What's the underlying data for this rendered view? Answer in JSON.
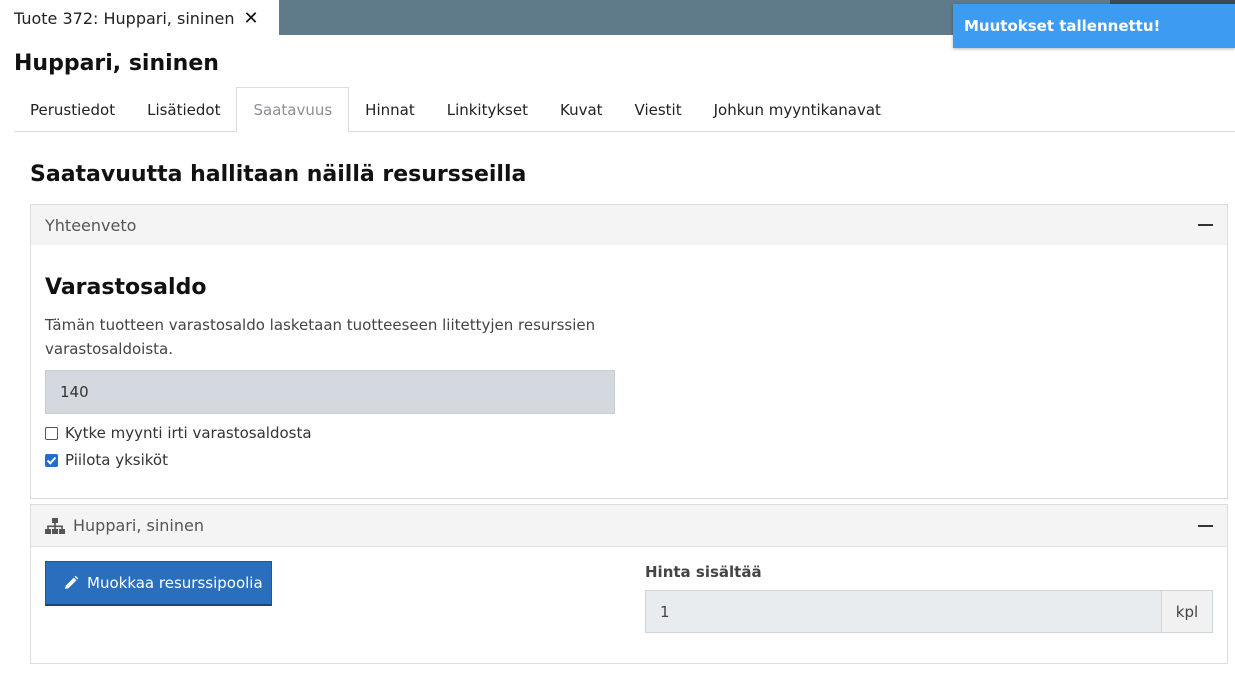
{
  "document_tab": {
    "title": "Tuote 372: Huppari, sininen",
    "close_glyph": "✕"
  },
  "toast": {
    "message": "Muutokset tallennettu!"
  },
  "page": {
    "title": "Huppari, sininen"
  },
  "tabs": [
    {
      "label": "Perustiedot",
      "active": false
    },
    {
      "label": "Lisätiedot",
      "active": false
    },
    {
      "label": "Saatavuus",
      "active": true
    },
    {
      "label": "Hinnat",
      "active": false
    },
    {
      "label": "Linkitykset",
      "active": false
    },
    {
      "label": "Kuvat",
      "active": false
    },
    {
      "label": "Viestit",
      "active": false
    },
    {
      "label": "Johkun myyntikanavat",
      "active": false
    }
  ],
  "availability": {
    "section_title": "Saatavuutta hallitaan näillä resursseilla",
    "summary_panel": {
      "header": "Yhteenveto",
      "subheading": "Varastosaldo",
      "description": "Tämän tuotteen varastosaldo lasketaan tuotteeseen liitettyjen resurssien varastosaldoista.",
      "stock_value": "140",
      "checkboxes": [
        {
          "label": "Kytke myynti irti varastosaldosta",
          "checked": false
        },
        {
          "label": "Piilota yksiköt",
          "checked": true
        }
      ]
    },
    "resource_panel": {
      "header": "Huppari, sininen",
      "header_icon": "sitemap-icon",
      "edit_button_label": "Muokkaa resurssipoolia",
      "edit_button_icon": "pencil-icon",
      "price_label": "Hinta sisältää",
      "price_value": "1",
      "price_unit": "kpl"
    }
  },
  "colors": {
    "topbar": "#5f7a89",
    "toast": "#3d9cf2",
    "primary_button": "#2a6fbd",
    "checkbox_checked": "#1f6fd1"
  }
}
